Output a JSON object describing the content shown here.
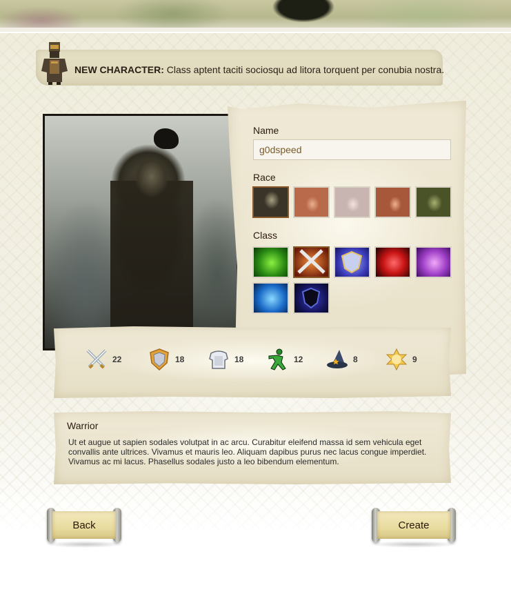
{
  "notice": {
    "heading": "NEW CHARACTER:",
    "message": "Class aptent taciti sociosqu ad litora torquent per conubia nostra."
  },
  "form": {
    "name_label": "Name",
    "name_value": "g0dspeed",
    "race_label": "Race",
    "class_label": "Class"
  },
  "races": [
    {
      "name": "undead",
      "selected": true
    },
    {
      "name": "elf-warrior",
      "selected": false
    },
    {
      "name": "ice-maiden",
      "selected": false
    },
    {
      "name": "red-elf",
      "selected": false
    },
    {
      "name": "orc",
      "selected": false
    }
  ],
  "classes": [
    {
      "name": "druid",
      "selected": false
    },
    {
      "name": "warrior",
      "selected": true
    },
    {
      "name": "paladin",
      "selected": false
    },
    {
      "name": "fire-mage",
      "selected": false
    },
    {
      "name": "necromancer",
      "selected": false
    },
    {
      "name": "rogue",
      "selected": false
    },
    {
      "name": "shadow-knight",
      "selected": false
    }
  ],
  "stats": [
    {
      "icon": "swords-icon",
      "value": "22"
    },
    {
      "icon": "shield-icon",
      "value": "18"
    },
    {
      "icon": "armor-icon",
      "value": "18"
    },
    {
      "icon": "agility-icon",
      "value": "12"
    },
    {
      "icon": "wizard-hat-icon",
      "value": "8"
    },
    {
      "icon": "star-icon",
      "value": "9"
    }
  ],
  "description": {
    "title": "Warrior",
    "body": "Ut et augue ut sapien sodales volutpat in ac arcu. Curabitur eleifend massa id sem vehicula eget convallis ante ultrices. Vivamus et mauris leo. Aliquam dapibus purus nec lacus congue imperdiet. Vivamus ac mi lacus. Phasellus sodales justo a leo bibendum elementum."
  },
  "buttons": {
    "back": "Back",
    "create": "Create"
  }
}
